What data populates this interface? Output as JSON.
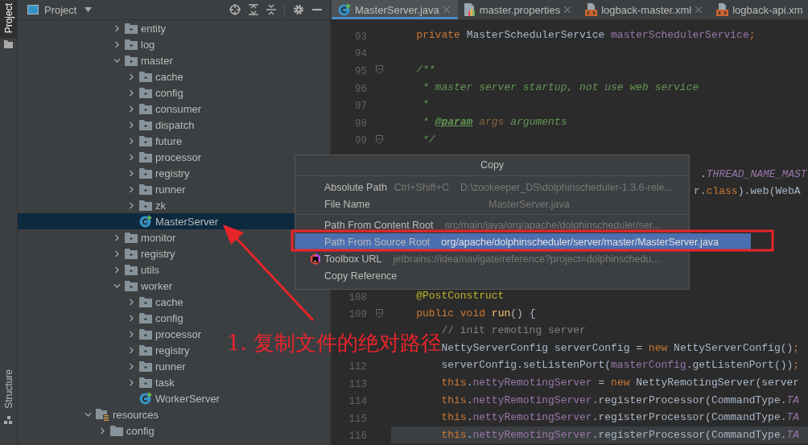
{
  "left_strip": {
    "top_tab": "Project",
    "bottom_tab": "Structure"
  },
  "project_panel": {
    "title": "Project"
  },
  "tree": [
    {
      "children": [
        {
          "children": [
            {
              "label": "entity",
              "kind": "package",
              "expanded": false,
              "selected": false
            },
            {
              "label": "log",
              "kind": "package",
              "expanded": false,
              "selected": false
            },
            {
              "label": "master",
              "kind": "package",
              "expanded": true,
              "selected": false,
              "children": [
                {
                  "label": "cache",
                  "kind": "package",
                  "expanded": false,
                  "selected": false
                },
                {
                  "label": "config",
                  "kind": "package",
                  "expanded": false,
                  "selected": false
                },
                {
                  "label": "consumer",
                  "kind": "package",
                  "expanded": false,
                  "selected": false
                },
                {
                  "label": "dispatch",
                  "kind": "package",
                  "expanded": false,
                  "selected": false
                },
                {
                  "label": "future",
                  "kind": "package",
                  "expanded": false,
                  "selected": false
                },
                {
                  "label": "processor",
                  "kind": "package",
                  "expanded": false,
                  "selected": false
                },
                {
                  "label": "registry",
                  "kind": "package",
                  "expanded": false,
                  "selected": false
                },
                {
                  "label": "runner",
                  "kind": "package",
                  "expanded": false,
                  "selected": false
                },
                {
                  "label": "zk",
                  "kind": "package",
                  "expanded": false,
                  "selected": false
                },
                {
                  "label": "MasterServer",
                  "kind": "class",
                  "selected": true
                }
              ]
            },
            {
              "label": "monitor",
              "kind": "package",
              "expanded": false,
              "selected": false
            },
            {
              "label": "registry",
              "kind": "package",
              "expanded": false,
              "selected": false
            },
            {
              "label": "utils",
              "kind": "package",
              "expanded": false,
              "selected": false
            },
            {
              "label": "worker",
              "kind": "package",
              "expanded": true,
              "selected": false,
              "children": [
                {
                  "label": "cache",
                  "kind": "package",
                  "expanded": false,
                  "selected": false
                },
                {
                  "label": "config",
                  "kind": "package",
                  "expanded": false,
                  "selected": false
                },
                {
                  "label": "processor",
                  "kind": "package",
                  "expanded": false,
                  "selected": false
                },
                {
                  "label": "registry",
                  "kind": "package",
                  "expanded": false,
                  "selected": false
                },
                {
                  "label": "runner",
                  "kind": "package",
                  "expanded": false,
                  "selected": false
                },
                {
                  "label": "task",
                  "kind": "package",
                  "expanded": false,
                  "selected": false
                },
                {
                  "label": "WorkerServer",
                  "kind": "class",
                  "selected": false
                }
              ]
            }
          ]
        }
      ]
    },
    {
      "label": "resources",
      "kind": "resources",
      "expanded": true,
      "selected": false,
      "children": [
        {
          "label": "config",
          "kind": "folder",
          "expanded": false,
          "selected": false
        }
      ]
    }
  ],
  "tabs": [
    {
      "label": "MasterServer.java",
      "kind": "class",
      "selected": true,
      "closable": true
    },
    {
      "label": "master.properties",
      "kind": "properties",
      "selected": false,
      "closable": true
    },
    {
      "label": "logback-master.xml",
      "kind": "xml",
      "selected": false,
      "closable": true
    },
    {
      "label": "logback-api.xm",
      "kind": "xml",
      "selected": false,
      "closable": false
    }
  ],
  "code_blocks": [
    {
      "lines": [
        {
          "number": "93",
          "tokens": [
            {
              "t": "    private ",
              "kind": "keyword"
            },
            {
              "t": "MasterSchedulerService ",
              "kind": "plain"
            },
            {
              "t": "masterSchedulerService",
              "kind": "field"
            },
            {
              "t": ";",
              "kind": "keyword"
            }
          ]
        },
        {
          "number": "94"
        },
        {
          "number": "95",
          "fold": true,
          "tokens": [
            {
              "t": "    /**",
              "kind": "doc"
            }
          ]
        },
        {
          "number": "96",
          "tokens": [
            {
              "t": "     * master server startup, not use web service",
              "kind": "doc"
            }
          ]
        },
        {
          "number": "97",
          "tokens": [
            {
              "t": "     *",
              "kind": "doc"
            }
          ]
        },
        {
          "number": "98",
          "tokens": [
            {
              "t": "     * ",
              "kind": "doc"
            },
            {
              "t": "@param",
              "kind": "tag"
            },
            {
              "t": " args",
              "kind": "docparam"
            },
            {
              "t": " arguments",
              "kind": "doc"
            }
          ]
        },
        {
          "number": "99",
          "fold": true,
          "tokens": [
            {
              "t": "     */",
              "kind": "doc"
            }
          ]
        }
      ]
    },
    {
      "lines": [
        {
          "tokens": [
            {
              "t": ".",
              "kind": "plain"
            },
            {
              "t": "THREAD_NAME_MAST",
              "kind": "constant"
            }
          ]
        },
        {
          "tokens": [
            {
              "t": "r.",
              "kind": "plain"
            },
            {
              "t": "class",
              "kind": "keyword"
            },
            {
              "t": ").web(WebA",
              "kind": "plain"
            }
          ]
        }
      ]
    },
    {
      "lines": [
        {
          "number": "108",
          "tokens": [
            {
              "t": "    @PostConstruct",
              "kind": "annotation"
            }
          ]
        },
        {
          "number": "109",
          "fold": true,
          "tokens": [
            {
              "t": "    public void ",
              "kind": "keyword"
            },
            {
              "t": "run",
              "kind": "method"
            },
            {
              "t": "() {",
              "kind": "plain"
            }
          ]
        },
        {
          "tokens": [
            {
              "t": "        // init remoting server",
              "kind": "comment"
            }
          ]
        },
        {
          "tokens": [
            {
              "t": "        NettyServerConfig serverConfig = ",
              "kind": "plain"
            },
            {
              "t": "new ",
              "kind": "keyword"
            },
            {
              "t": "NettyServerConfig()",
              "kind": "plain"
            },
            {
              "t": ";",
              "kind": "keyword"
            }
          ]
        },
        {
          "number": "112",
          "tokens": [
            {
              "t": "        serverConfig.setListenPort(",
              "kind": "plain"
            },
            {
              "t": "masterConfig",
              "kind": "field"
            },
            {
              "t": ".getListenPort())",
              "kind": "plain"
            },
            {
              "t": ";",
              "kind": "keyword"
            }
          ]
        },
        {
          "number": "113",
          "tokens": [
            {
              "t": "        this",
              "kind": "keyword"
            },
            {
              "t": ".",
              "kind": "plain"
            },
            {
              "t": "nettyRemotingServer",
              "kind": "field"
            },
            {
              "t": " = ",
              "kind": "plain"
            },
            {
              "t": "new ",
              "kind": "keyword"
            },
            {
              "t": "NettyRemotingServer(server",
              "kind": "plain"
            }
          ]
        },
        {
          "number": "114",
          "tokens": [
            {
              "t": "        this",
              "kind": "keyword"
            },
            {
              "t": ".",
              "kind": "plain"
            },
            {
              "t": "nettyRemotingServer",
              "kind": "field"
            },
            {
              "t": ".registerProcessor(CommandType.",
              "kind": "plain"
            },
            {
              "t": "TA",
              "kind": "constant"
            }
          ]
        },
        {
          "number": "115",
          "tokens": [
            {
              "t": "        this",
              "kind": "keyword"
            },
            {
              "t": ".",
              "kind": "plain"
            },
            {
              "t": "nettyRemotingServer",
              "kind": "field"
            },
            {
              "t": ".registerProcessor(CommandType.",
              "kind": "plain"
            },
            {
              "t": "TA",
              "kind": "constant"
            }
          ]
        },
        {
          "number": "116",
          "current": true,
          "tokens": [
            {
              "t": "        this",
              "kind": "keyword"
            },
            {
              "t": ".",
              "kind": "plain"
            },
            {
              "t": "nettyRemotingServer",
              "kind": "field"
            },
            {
              "t": ".registerProcessor(CommandType.",
              "kind": "plain"
            },
            {
              "t": "TA",
              "kind": "constant"
            }
          ]
        }
      ]
    }
  ],
  "copy_menu": {
    "title": "Copy",
    "items": [
      {
        "label": "Absolute Path",
        "shortcut": "Ctrl+Shift+C",
        "value": "D:\\zookeeper_DS\\dolphinscheduler-1.3.6-rele...",
        "selected": false
      },
      {
        "label": "File Name",
        "value": "MasterServer.java",
        "selected": false
      },
      {
        "label": "Path From Content Root",
        "value": "src/main/java/org/apache/dolphinscheduler/ser...",
        "selected": false,
        "separator_before": true
      },
      {
        "label": "Path From Source Root",
        "value": "org/apache/dolphinscheduler/server/master/MasterServer.java",
        "selected": true
      },
      {
        "label": "Toolbox URL",
        "value": "jetbrains://idea/navigate/reference?project=dolphinschedu...",
        "selected": false,
        "icon": true
      },
      {
        "label": "Copy Reference",
        "selected": false
      }
    ]
  },
  "annotation": {
    "text": "1. 复制文件的绝对路径"
  }
}
